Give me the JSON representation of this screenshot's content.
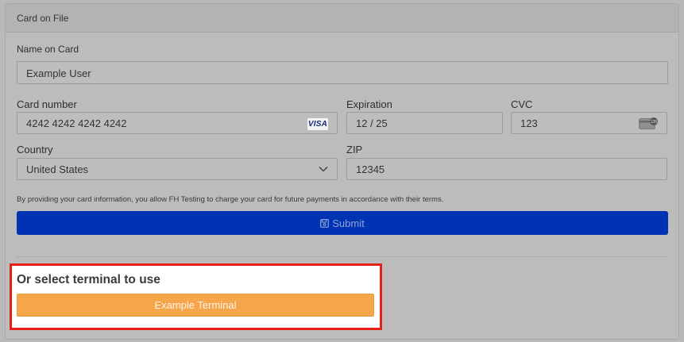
{
  "card_header": {
    "title": "Card on File"
  },
  "name_on_card": {
    "label": "Name on Card",
    "value": "Example User"
  },
  "card_number": {
    "label": "Card number",
    "value": "4242 4242 4242 4242",
    "brand": "VISA"
  },
  "expiration": {
    "label": "Expiration",
    "value": "12 / 25"
  },
  "cvc": {
    "label": "CVC",
    "value": "123",
    "icon": "cvc-card-icon"
  },
  "country": {
    "label": "Country",
    "value": "United States"
  },
  "zip": {
    "label": "ZIP",
    "value": "12345"
  },
  "terms_text": "By providing your card information, you allow FH Testing to charge your card for future payments in accordance with their terms.",
  "submit": {
    "label": "Submit",
    "icon": "save-icon",
    "color": "#0033b3"
  },
  "terminal": {
    "title": "Or select terminal to use",
    "button_label": "Example Terminal",
    "button_color": "#f5a64a",
    "highlight_color": "#e52017"
  }
}
